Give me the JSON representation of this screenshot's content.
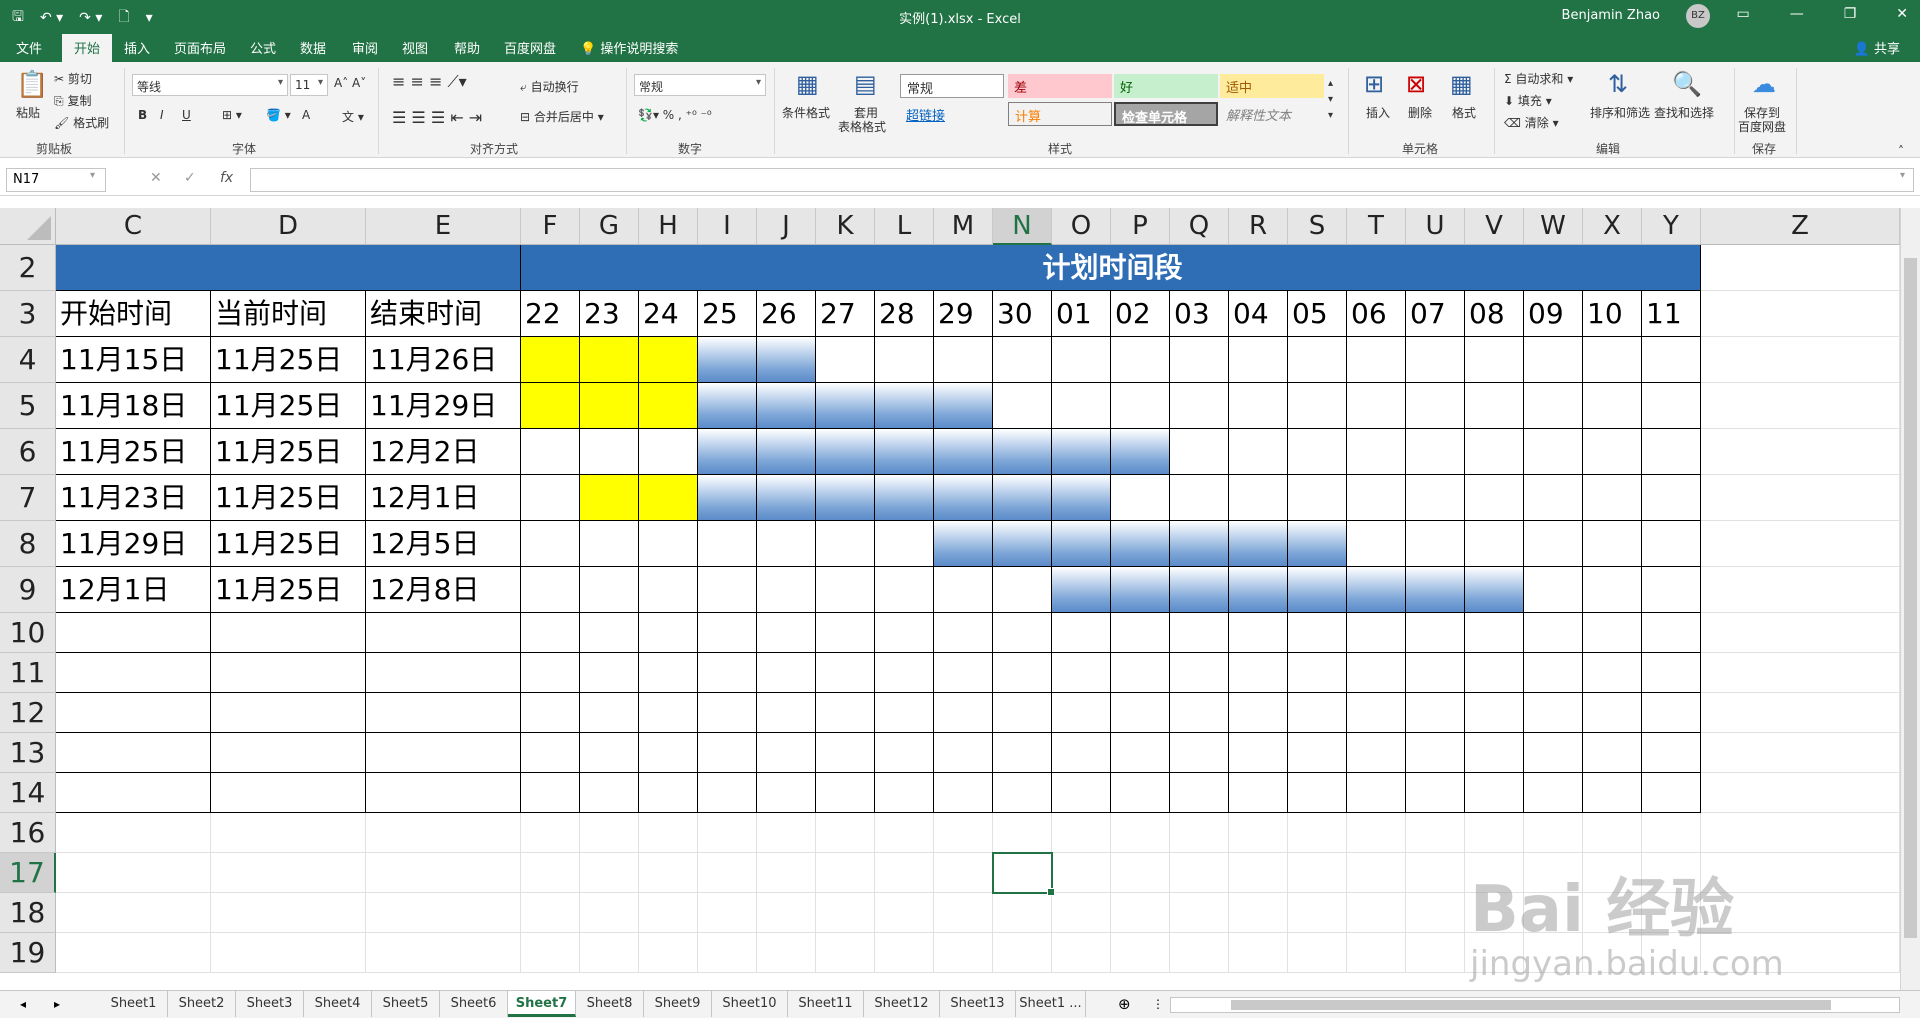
{
  "window": {
    "title": "实例(1).xlsx - Excel",
    "user": "Benjamin Zhao",
    "initials": "BZ"
  },
  "tabs": [
    "文件",
    "开始",
    "插入",
    "页面布局",
    "公式",
    "数据",
    "审阅",
    "视图",
    "帮助",
    "百度网盘",
    "操作说明搜索"
  ],
  "share": "共享",
  "ribbon": {
    "clipboard": {
      "paste": "粘贴",
      "cut": "剪切",
      "copy": "复制",
      "painter": "格式刷",
      "label": "剪贴板"
    },
    "font": {
      "name": "等线",
      "size": "11",
      "label": "字体",
      "bold": "B",
      "italic": "I",
      "underline": "U",
      "font_color": "A"
    },
    "align": {
      "wrap": "自动换行",
      "merge": "合并后居中",
      "label": "对齐方式"
    },
    "number": {
      "format": "常规",
      "label": "数字"
    },
    "styles": {
      "cond": "条件格式",
      "table1": "套用",
      "table2": "表格格式",
      "normal": "常规",
      "bad": "差",
      "good": "好",
      "neutral": "适中",
      "hyperlink": "超链接",
      "calc": "计算",
      "check": "检查单元格",
      "explain": "解释性文本",
      "label": "样式"
    },
    "cells": {
      "insert": "插入",
      "delete": "删除",
      "format": "格式",
      "label": "单元格"
    },
    "edit": {
      "autosum": "自动求和",
      "fill": "填充",
      "clear": "清除",
      "sort": "排序和筛选",
      "find": "查找和选择",
      "label": "编辑"
    },
    "save": {
      "btn1": "保存到",
      "btn2": "百度网盘",
      "label": "保存"
    }
  },
  "colors": {
    "excel_green": "#217346",
    "band_blue": "#2f6db5",
    "highlight_yellow": "#ffff00"
  },
  "formula": {
    "namebox": "N17",
    "fx": "fx",
    "cancel": "✕",
    "enter": "✓",
    "content": ""
  },
  "grid": {
    "columns": [
      "C",
      "D",
      "E",
      "F",
      "G",
      "H",
      "I",
      "J",
      "K",
      "L",
      "M",
      "N",
      "O",
      "P",
      "Q",
      "R",
      "S",
      "T",
      "U",
      "V",
      "W",
      "X",
      "Y",
      "Z"
    ],
    "rows": [
      "2",
      "3",
      "4",
      "5",
      "6",
      "7",
      "8",
      "9",
      "10",
      "11",
      "12",
      "13",
      "14",
      "16",
      "17",
      "18",
      "19"
    ],
    "band_title": "计划时间段",
    "headers": [
      "开始时间",
      "当前时间",
      "结束时间"
    ],
    "days": [
      "22",
      "23",
      "24",
      "25",
      "26",
      "27",
      "28",
      "29",
      "30",
      "01",
      "02",
      "03",
      "04",
      "05",
      "06",
      "07",
      "08",
      "09",
      "10",
      "11"
    ],
    "records": [
      {
        "start": "11月15日",
        "current": "11月25日",
        "end": "11月26日",
        "yellow": [
          0,
          1,
          2
        ],
        "blue": [
          3,
          4
        ]
      },
      {
        "start": "11月18日",
        "current": "11月25日",
        "end": "11月29日",
        "yellow": [
          0,
          1,
          2
        ],
        "blue": [
          3,
          4,
          5,
          6,
          7
        ]
      },
      {
        "start": "11月25日",
        "current": "11月25日",
        "end": "12月2日",
        "yellow": [],
        "blue": [
          3,
          4,
          5,
          6,
          7,
          8,
          9,
          10
        ]
      },
      {
        "start": "11月23日",
        "current": "11月25日",
        "end": "12月1日",
        "yellow": [
          1,
          2
        ],
        "blue": [
          3,
          4,
          5,
          6,
          7,
          8,
          9
        ]
      },
      {
        "start": "11月29日",
        "current": "11月25日",
        "end": "12月5日",
        "yellow": [],
        "blue": [
          7,
          8,
          9,
          10,
          11,
          12,
          13
        ]
      },
      {
        "start": "12月1日",
        "current": "11月25日",
        "end": "12月8日",
        "yellow": [],
        "blue": [
          9,
          10,
          11,
          12,
          13,
          14,
          15,
          16
        ]
      }
    ]
  },
  "sheets": [
    "Sheet1",
    "Sheet2",
    "Sheet3",
    "Sheet4",
    "Sheet5",
    "Sheet6",
    "Sheet7",
    "Sheet8",
    "Sheet9",
    "Sheet10",
    "Sheet11",
    "Sheet12",
    "Sheet13",
    "Sheet1 ..."
  ],
  "active_sheet": "Sheet7",
  "watermark": {
    "brand": "Bai 经验",
    "url": "jingyan.baidu.com"
  }
}
